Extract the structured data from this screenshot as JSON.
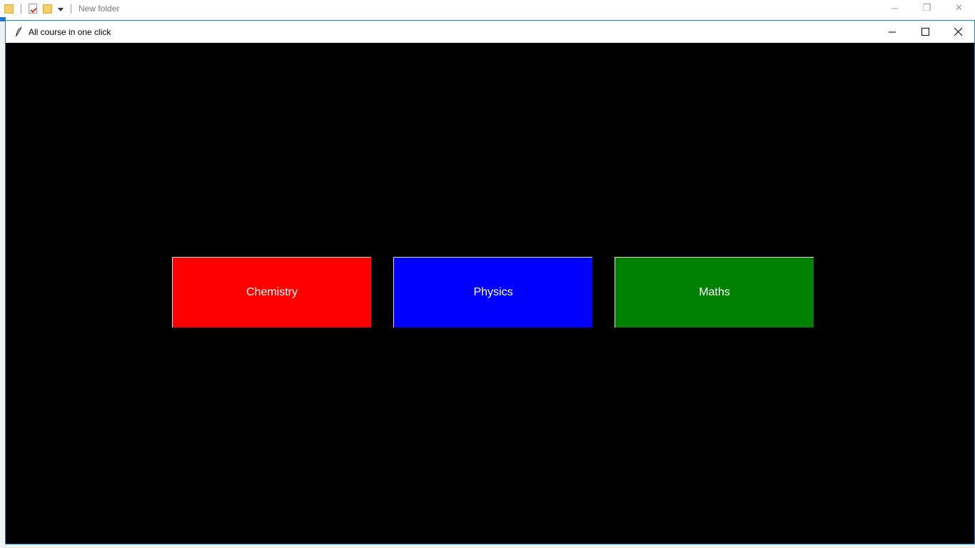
{
  "background_window": {
    "title": "New folder",
    "controls": {
      "minimize": "─",
      "restore": "❐",
      "close": "✕"
    }
  },
  "app": {
    "title": "All course in one click",
    "icon": "feather-icon",
    "controls": {
      "minimize_icon": "minimize-icon",
      "maximize_icon": "maximize-icon",
      "close_icon": "close-icon"
    },
    "background_color": "#000000"
  },
  "buttons": [
    {
      "label": "Chemistry",
      "color": "#ff0000"
    },
    {
      "label": "Physics",
      "color": "#0000ff"
    },
    {
      "label": "Maths",
      "color": "#008000"
    }
  ]
}
